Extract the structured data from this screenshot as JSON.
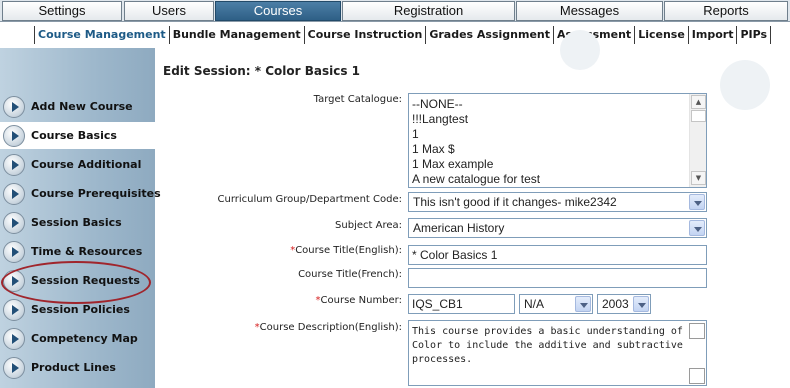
{
  "top_tabs": [
    {
      "label": "Settings",
      "active": false
    },
    {
      "label": "Users",
      "active": false
    },
    {
      "label": "Courses",
      "active": true
    },
    {
      "label": "Registration",
      "active": false
    },
    {
      "label": "Messages",
      "active": false
    },
    {
      "label": "Reports",
      "active": false
    }
  ],
  "sub_nav": [
    "Course Management",
    "Bundle Management",
    "Course Instruction",
    "Grades Assignment",
    "Assessment",
    "License",
    "Import",
    "PIPs"
  ],
  "sidebar": {
    "items": [
      {
        "label": "Add New Course"
      },
      {
        "label": "Course Basics"
      },
      {
        "label": "Course Additional"
      },
      {
        "label": "Course Prerequisites"
      },
      {
        "label": "Session Basics"
      },
      {
        "label": "Time & Resources"
      },
      {
        "label": "Session Requests"
      },
      {
        "label": "Session Policies"
      },
      {
        "label": "Competency Map"
      },
      {
        "label": "Product Lines"
      }
    ],
    "active_item": "Course Basics",
    "highlighted_item": "Session Requests"
  },
  "main": {
    "title": "Edit Session: * Color Basics 1",
    "target_catalogue": {
      "label": "Target Catalogue:",
      "options": [
        "--NONE--",
        "!!!Langtest",
        "1",
        "1 Max $",
        "1 Max example",
        "A new catalogue for test"
      ]
    },
    "curriculum_group": {
      "label": "Curriculum Group/Department Code:",
      "value": "This isn't good if it changes- mike2342"
    },
    "subject_area": {
      "label": "Subject Area:",
      "value": "American History"
    },
    "course_title_en": {
      "required_mark": "*",
      "label": "Course Title(English):",
      "value": "* Color Basics 1"
    },
    "course_title_fr": {
      "label": "Course Title(French):",
      "value": ""
    },
    "course_number": {
      "required_mark": "*",
      "label": "Course Number:",
      "value": "IQS_CB1",
      "suffix_value": "N/A",
      "year_value": "2003"
    },
    "course_description_en": {
      "required_mark": "*",
      "label": "Course Description(English):",
      "value": "This course provides a basic understanding of Color to include the additive and subtractive processes."
    }
  },
  "colors": {
    "active_tab": "#2e5f86",
    "sidebar": "#9eb8cc",
    "required": "#d62020",
    "highlight_ring": "#a0252c"
  }
}
